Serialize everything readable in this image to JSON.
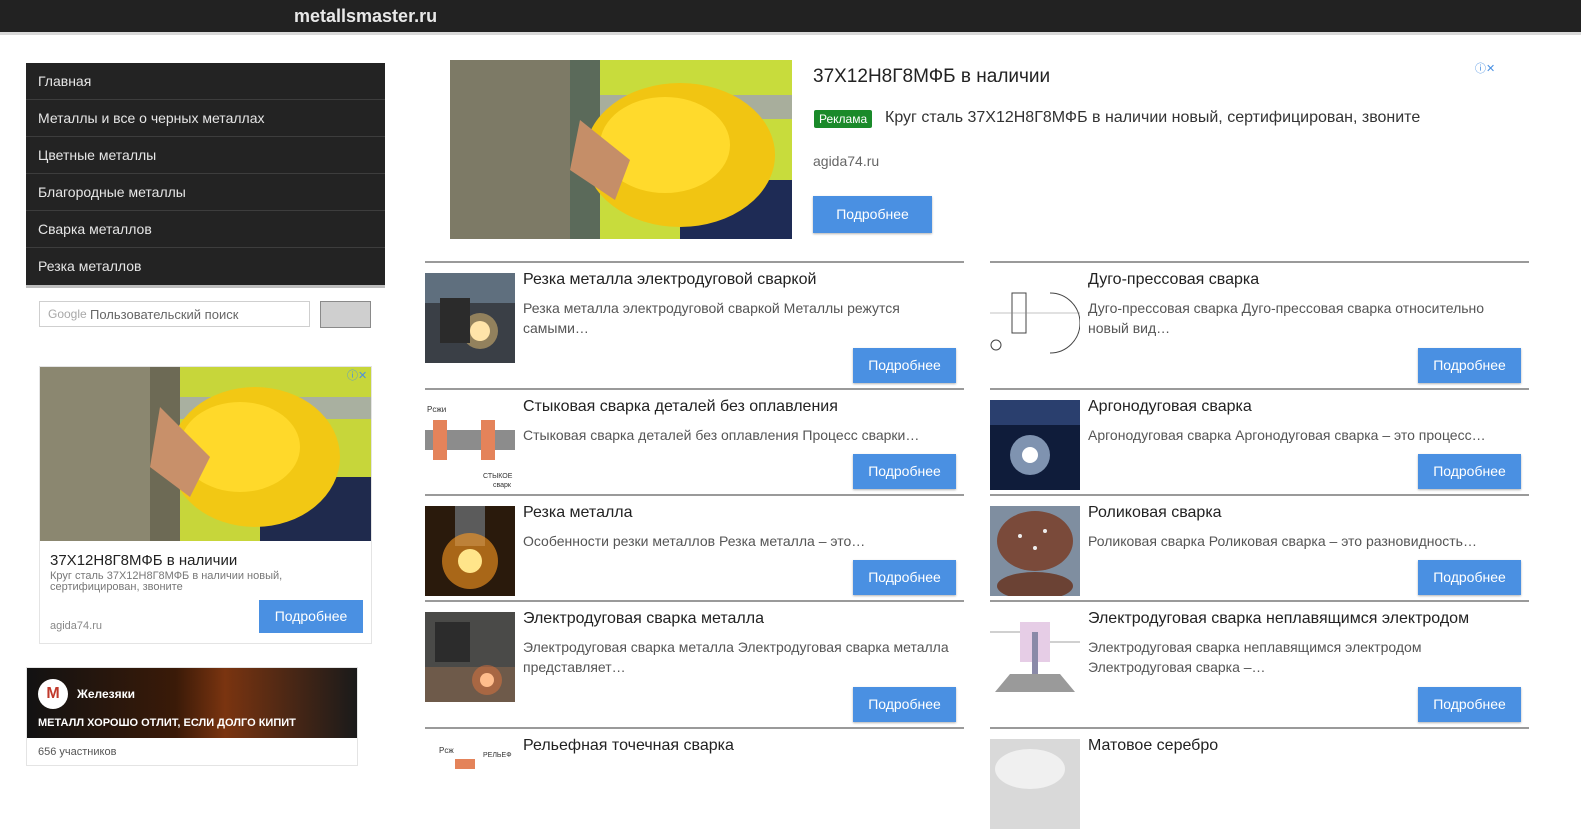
{
  "site": {
    "title": "metallsmaster.ru"
  },
  "menu": {
    "items": [
      {
        "label": "Главная"
      },
      {
        "label": "Металлы и все о черных металлах"
      },
      {
        "label": "Цветные металлы"
      },
      {
        "label": "Благородные металлы"
      },
      {
        "label": "Сварка металлов"
      },
      {
        "label": "Резка металлов"
      }
    ]
  },
  "search": {
    "google_label": "Google",
    "placeholder": "Пользовательский поиск"
  },
  "side_ad": {
    "title": "37Х12Н8Г8МФБ в наличии",
    "description": "Круг сталь 37Х12Н8Г8МФБ в наличии новый, сертифицирован, звоните",
    "domain": "agida74.ru",
    "button": "Подробнее"
  },
  "top_ad": {
    "title": "37Х12Н8Г8МФБ в наличии",
    "badge": "Реклама",
    "description": "Круг сталь 37Х12Н8Г8МФБ в наличии новый, сертифицирован, звоните",
    "domain": "agida74.ru",
    "button": "Подробнее"
  },
  "widget": {
    "logo_letter": "М",
    "name": "Железяки",
    "slogan": "МЕТАЛЛ ХОРОШО ОТЛИТ, ЕСЛИ ДОЛГО КИПИТ",
    "members": "656 участников"
  },
  "articles": {
    "left": [
      {
        "title": "Резка металла электродуговой сваркой",
        "desc": "Резка металла электродуговой сваркой Металлы режутся самыми…",
        "button": "Подробнее",
        "thumb": "arc-cutting"
      },
      {
        "title": "Стыковая сварка деталей без оплавления",
        "desc": "Стыковая сварка деталей без оплавления Процесс сварки…",
        "button": "Подробнее",
        "thumb": "butt-welding-diagram",
        "thumb_label_1": "Рсжи",
        "thumb_label_2": "СТЫКОЕ",
        "thumb_label_3": "сварк"
      },
      {
        "title": "Резка металла",
        "desc": "Особенности резки металлов Резка металла – это…",
        "button": "Подробнее",
        "thumb": "metal-cutting-sparks"
      },
      {
        "title": "Электродуговая сварка металла",
        "desc": "Электродуговая сварка металла Электродуговая сварка металла представляет…",
        "button": "Подробнее",
        "thumb": "arc-welding"
      },
      {
        "title": "Рельефная точечная сварка",
        "thumb": "relief-welding-diagram",
        "thumb_label_1": "Рсж",
        "thumb_label_2": "РЕЛЬЕФ"
      }
    ],
    "right": [
      {
        "title": "Дуго-прессовая сварка",
        "desc": "Дуго-прессовая сварка Дуго-прессовая сварка относительно новый вид…",
        "button": "Подробнее",
        "thumb": "arc-press-diagram"
      },
      {
        "title": "Аргонодуговая сварка",
        "desc": "Аргонодуговая сварка Аргонодуговая сварка – это процесс…",
        "button": "Подробнее",
        "thumb": "argon-welding"
      },
      {
        "title": "Роликовая сварка",
        "desc": "Роликовая сварка Роликовая сварка  – это разновидность…",
        "button": "Подробнее",
        "thumb": "roller-welding"
      },
      {
        "title": "Электродуговая сварка неплавящимся электродом",
        "desc": "Электродуговая сварка неплавящимся электродом Электродуговая сварка –…",
        "button": "Подробнее",
        "thumb": "tig-diagram"
      },
      {
        "title": "Матовое серебро",
        "thumb": "matte-silver"
      }
    ]
  },
  "colors": {
    "accent": "#4a90e2",
    "header_bg": "#222222",
    "menu_bg": "#232323",
    "badge_green": "#1a8a2a"
  }
}
